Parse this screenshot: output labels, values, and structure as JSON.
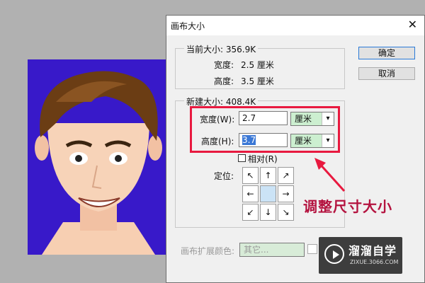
{
  "window": {
    "title": "画布大小",
    "close_glyph": "✕"
  },
  "current_size": {
    "label": "当前大小: 356.9K",
    "width_label": "宽度:",
    "width_value": "2.5 厘米",
    "height_label": "高度:",
    "height_value": "3.5 厘米"
  },
  "new_size": {
    "label": "新建大小: 408.4K",
    "width_label": "宽度(W):",
    "width_value": "2.7",
    "width_unit": "厘米",
    "height_label": "高度(H):",
    "height_value": "3.7",
    "height_unit": "厘米",
    "relative_label": "相对(R)",
    "anchor_label": "定位:"
  },
  "buttons": {
    "ok": "确定",
    "cancel": "取消"
  },
  "extension": {
    "label": "画布扩展颜色:",
    "value": "其它..."
  },
  "annotation": "调整尺寸大小",
  "watermark": {
    "name": "溜溜自学",
    "url": "ZIXUE.3066.COM"
  },
  "colors": {
    "highlight_box": "#e8193f",
    "annotation": "#b4133f",
    "canvas_bg": "#3819c9"
  }
}
